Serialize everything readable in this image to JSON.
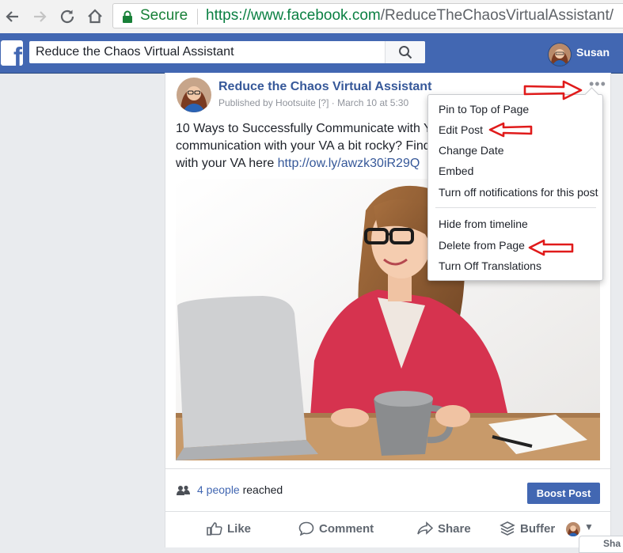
{
  "browser": {
    "secure_label": "Secure",
    "url_scheme": "https://",
    "url_host": "www.facebook.com",
    "url_path": "/ReduceTheChaosVirtualAssistant/"
  },
  "facebook": {
    "logo_letter": "f",
    "search_value": "Reduce the Chaos Virtual Assistant",
    "user_name": "Susan",
    "brand_color": "#4267b2"
  },
  "post": {
    "page_name": "Reduce the Chaos Virtual Assistant",
    "meta": "Published by Hootsuite [?] · March 10 at 5:30",
    "text_line1": "10 Ways to Successfully Communicate with Y",
    "text_line2": "communication with your VA a bit rocky? Find",
    "text_line3_prefix": "with your VA here ",
    "link": "http://ow.ly/awzk30iR29Q",
    "reach_count": "4 people",
    "reach_suffix": " reached",
    "boost_label": "Boost Post"
  },
  "actions": {
    "like": "Like",
    "comment": "Comment",
    "share": "Share",
    "buffer": "Buffer"
  },
  "menu": {
    "items": [
      "Pin to Top of Page",
      "Edit Post",
      "Change Date",
      "Embed",
      "Turn off notifications for this post",
      "Hide from timeline",
      "Delete from Page",
      "Turn Off Translations"
    ]
  },
  "corner_tab": "Sha",
  "annotation_color": "#e01b1b"
}
